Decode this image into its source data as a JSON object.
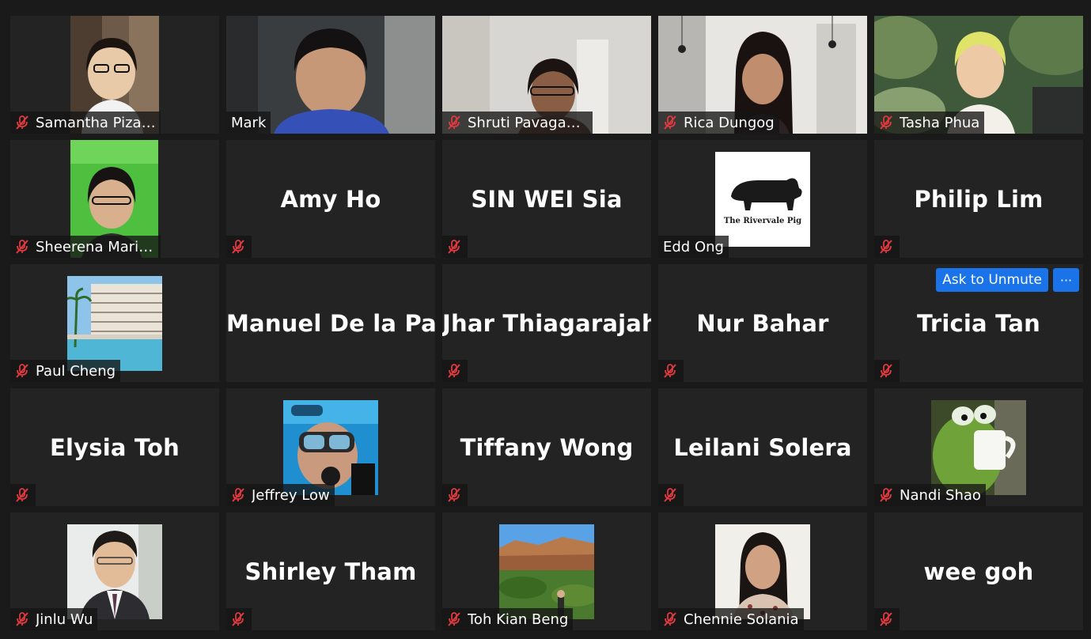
{
  "participants": [
    {
      "name": "Samantha Pizar...",
      "muted": true
    },
    {
      "name": "Mark",
      "muted": false
    },
    {
      "name": "Shruti Pavagadhi",
      "muted": true
    },
    {
      "name": "Rica Dungog",
      "muted": true
    },
    {
      "name": "Tasha Phua",
      "muted": true
    },
    {
      "name": "Sheerena Marie...",
      "muted": true
    },
    {
      "name": "Amy Ho",
      "muted": true
    },
    {
      "name": "SIN WEI Sia",
      "muted": true
    },
    {
      "name": "Edd Ong",
      "muted": false,
      "logo_text": "The Rivervale Pig"
    },
    {
      "name": "Philip Lim",
      "muted": true
    },
    {
      "name": "Paul Cheng",
      "muted": true
    },
    {
      "name": "Manuel De la Paz",
      "muted": false
    },
    {
      "name": "Jhar Thiagarajah",
      "muted": true
    },
    {
      "name": "Nur Bahar",
      "muted": true
    },
    {
      "name": "Tricia Tan",
      "muted": true
    },
    {
      "name": "Elysia Toh",
      "muted": true
    },
    {
      "name": "Jeffrey Low",
      "muted": true
    },
    {
      "name": "Tiffany Wong",
      "muted": true
    },
    {
      "name": "Leilani Solera",
      "muted": true
    },
    {
      "name": "Nandi Shao",
      "muted": true
    },
    {
      "name": "Jinlu Wu",
      "muted": true
    },
    {
      "name": "Shirley Tham",
      "muted": true
    },
    {
      "name": "Toh Kian Beng",
      "muted": true
    },
    {
      "name": "Chennie Solania",
      "muted": true
    },
    {
      "name": "wee goh",
      "muted": true
    }
  ],
  "actions": {
    "ask_to_unmute": "Ask to Unmute",
    "more": "···"
  },
  "colors": {
    "background": "#1a1a1a",
    "tile": "#232323",
    "accent": "#1a73e8",
    "mute_icon": "#e0393e"
  }
}
